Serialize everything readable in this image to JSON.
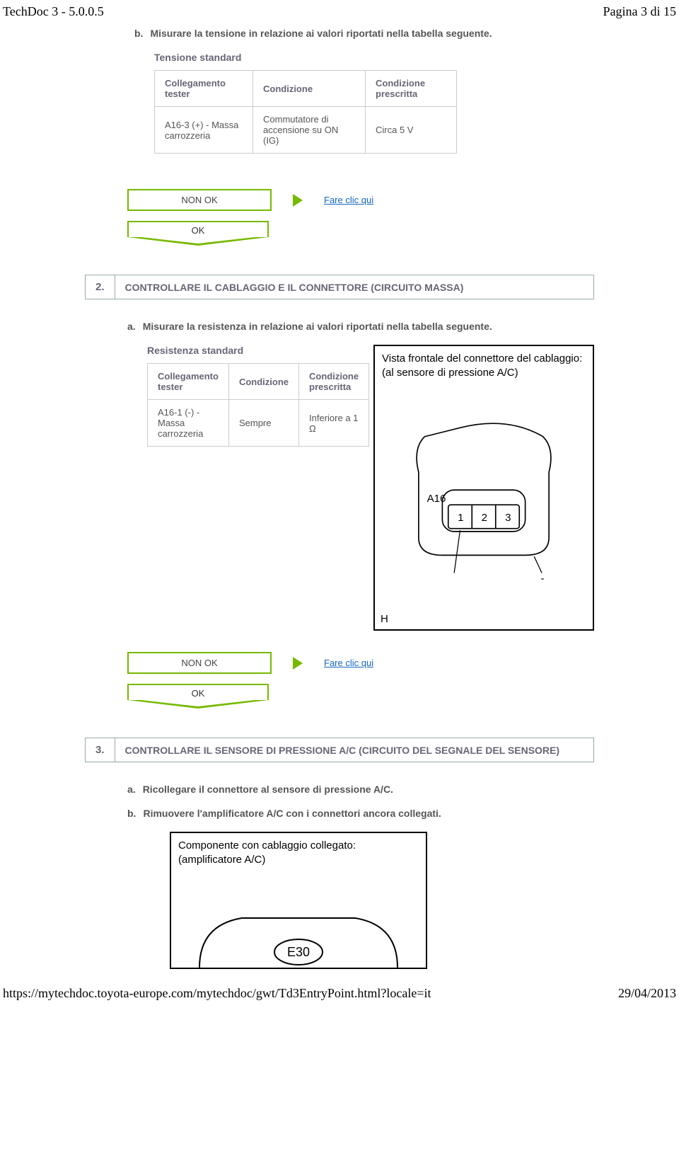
{
  "header": {
    "left": "TechDoc 3 - 5.0.0.5",
    "right": "Pagina 3 di 15"
  },
  "step_b": {
    "letter": "b.",
    "text": "Misurare la tensione in relazione ai valori riportati nella tabella seguente."
  },
  "tensione": {
    "label": "Tensione standard",
    "headers": {
      "c1": "Collegamento tester",
      "c2": "Condizione",
      "c3": "Condizione prescritta"
    },
    "row": {
      "c1": "A16-3 (+) - Massa carrozzeria",
      "c2": "Commutatore di accensione su ON (IG)",
      "c3": "Circa 5 V"
    }
  },
  "flow": {
    "non_ok": "NON OK",
    "link": "Fare clic qui",
    "ok": "OK"
  },
  "step2": {
    "num": "2.",
    "title": "CONTROLLARE IL CABLAGGIO E IL CONNETTORE (CIRCUITO MASSA)"
  },
  "step2_a": {
    "letter": "a.",
    "text": "Misurare la resistenza in relazione ai valori riportati nella tabella seguente."
  },
  "resistenza": {
    "label": "Resistenza standard",
    "headers": {
      "c1": "Collegamento tester",
      "c2": "Condizione",
      "c3": "Condizione prescritta"
    },
    "row": {
      "c1": "A16-1 (-) - Massa carrozzeria",
      "c2": "Sempre",
      "c3": "Inferiore a 1 Ω"
    }
  },
  "diagram": {
    "title": "Vista frontale del connettore del cablaggio: (al sensore di pressione A/C)",
    "pin_a16": "A16",
    "pins": {
      "p1": "1",
      "p2": "2",
      "p3": "3"
    },
    "minus": "-",
    "h": "H"
  },
  "step3": {
    "num": "3.",
    "title": "CONTROLLARE IL SENSORE DI PRESSIONE A/C (CIRCUITO DEL SEGNALE DEL SENSORE)"
  },
  "step3_a": {
    "letter": "a.",
    "text": "Ricollegare il connettore al sensore di pressione A/C."
  },
  "step3_b": {
    "letter": "b.",
    "text": "Rimuovere l'amplificatore A/C con i connettori ancora collegati."
  },
  "diagram2": {
    "title": "Componente con cablaggio collegato: (amplificatore A/C)",
    "label": "E30"
  },
  "footer": {
    "left": "https://mytechdoc.toyota-europe.com/mytechdoc/gwt/Td3EntryPoint.html?locale=it",
    "right": "29/04/2013"
  }
}
